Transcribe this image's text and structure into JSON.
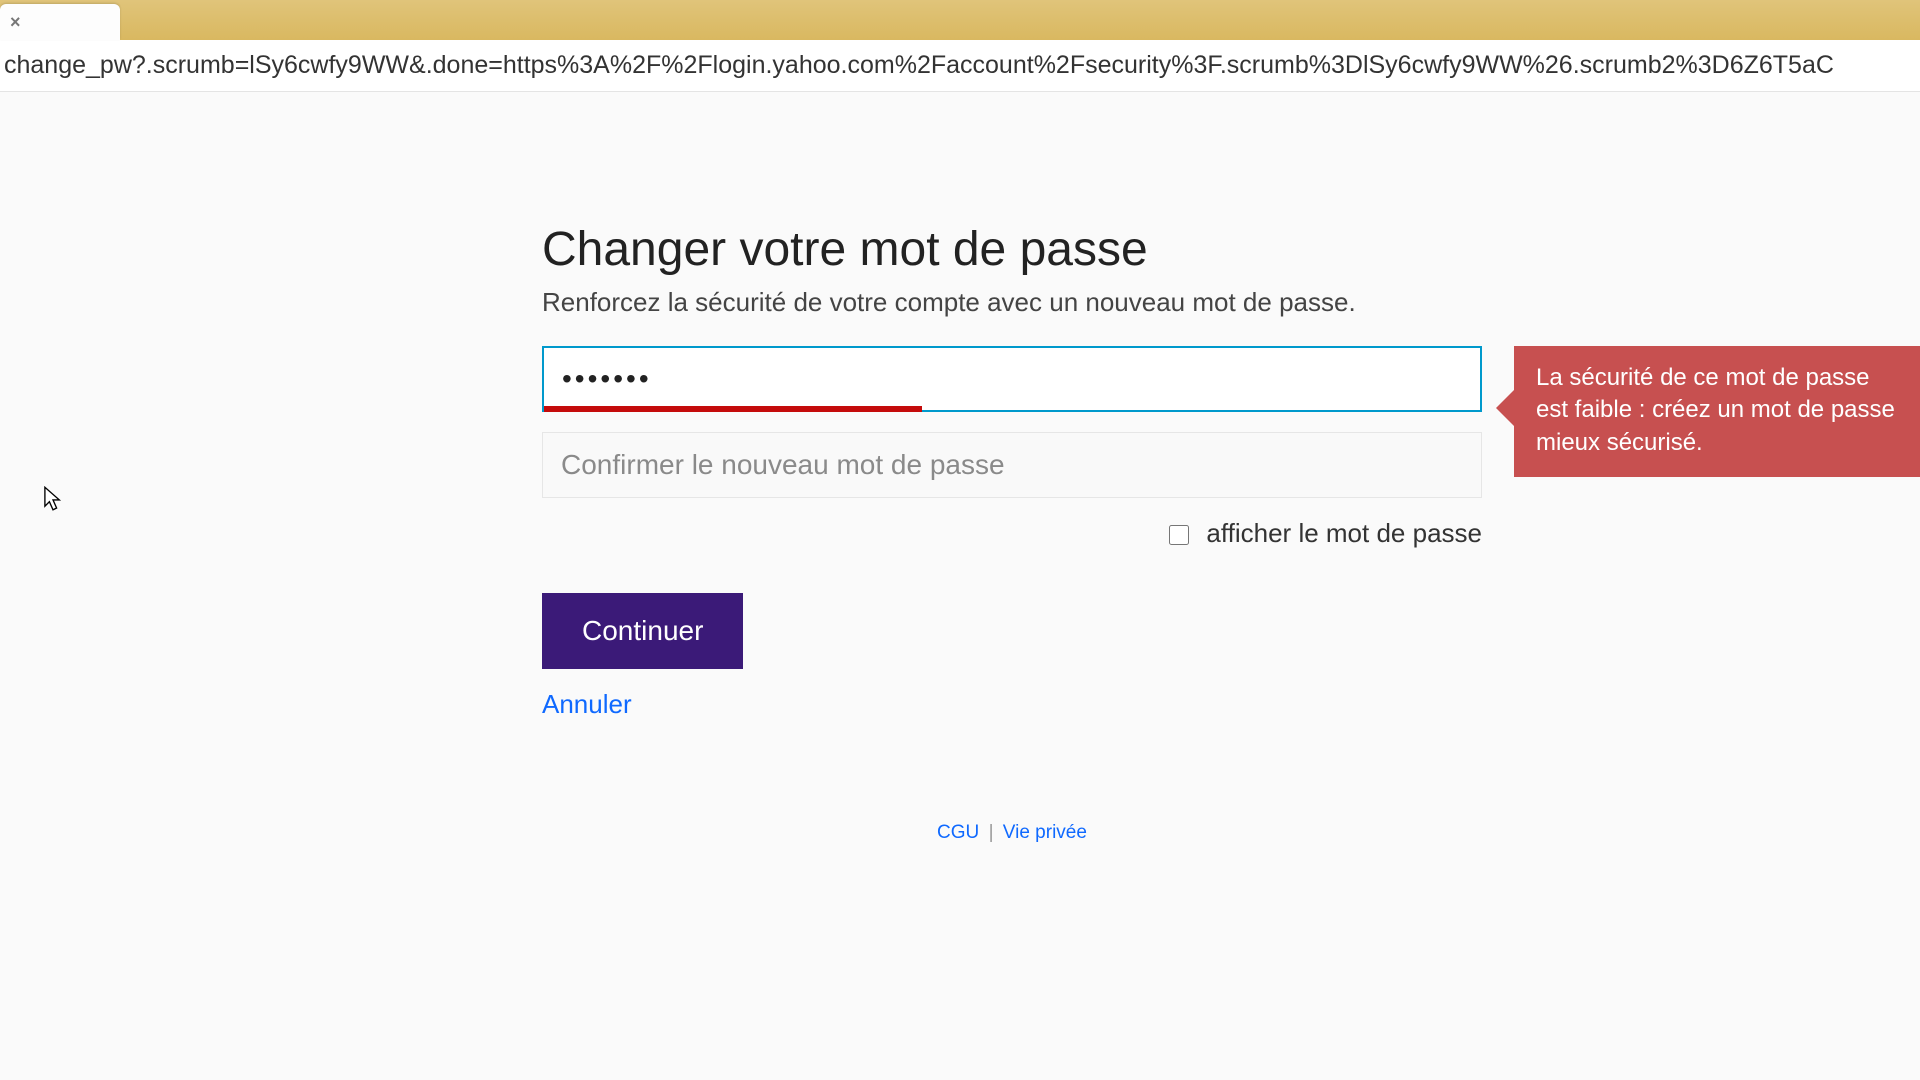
{
  "browser": {
    "url": "change_pw?.scrumb=lSy6cwfy9WW&.done=https%3A%2F%2Flogin.yahoo.com%2Faccount%2Fsecurity%3F.scrumb%3DlSy6cwfy9WW%26.scrumb2%3D6Z6T5aC"
  },
  "page": {
    "title": "Changer votre mot de passe",
    "subtitle": "Renforcez la sécurité de votre compte avec un nouveau mot de passe."
  },
  "form": {
    "password_value": "•••••••",
    "confirm_placeholder": "Confirmer le nouveau mot de passe",
    "show_password_label": "afficher le mot de passe",
    "continue_label": "Continuer",
    "cancel_label": "Annuler"
  },
  "tooltip": {
    "text": "La sécurité de ce mot de passe est faible : créez un mot de passe mieux sécurisé."
  },
  "footer": {
    "tos": "CGU",
    "privacy": "Vie privée",
    "separator": "|"
  }
}
